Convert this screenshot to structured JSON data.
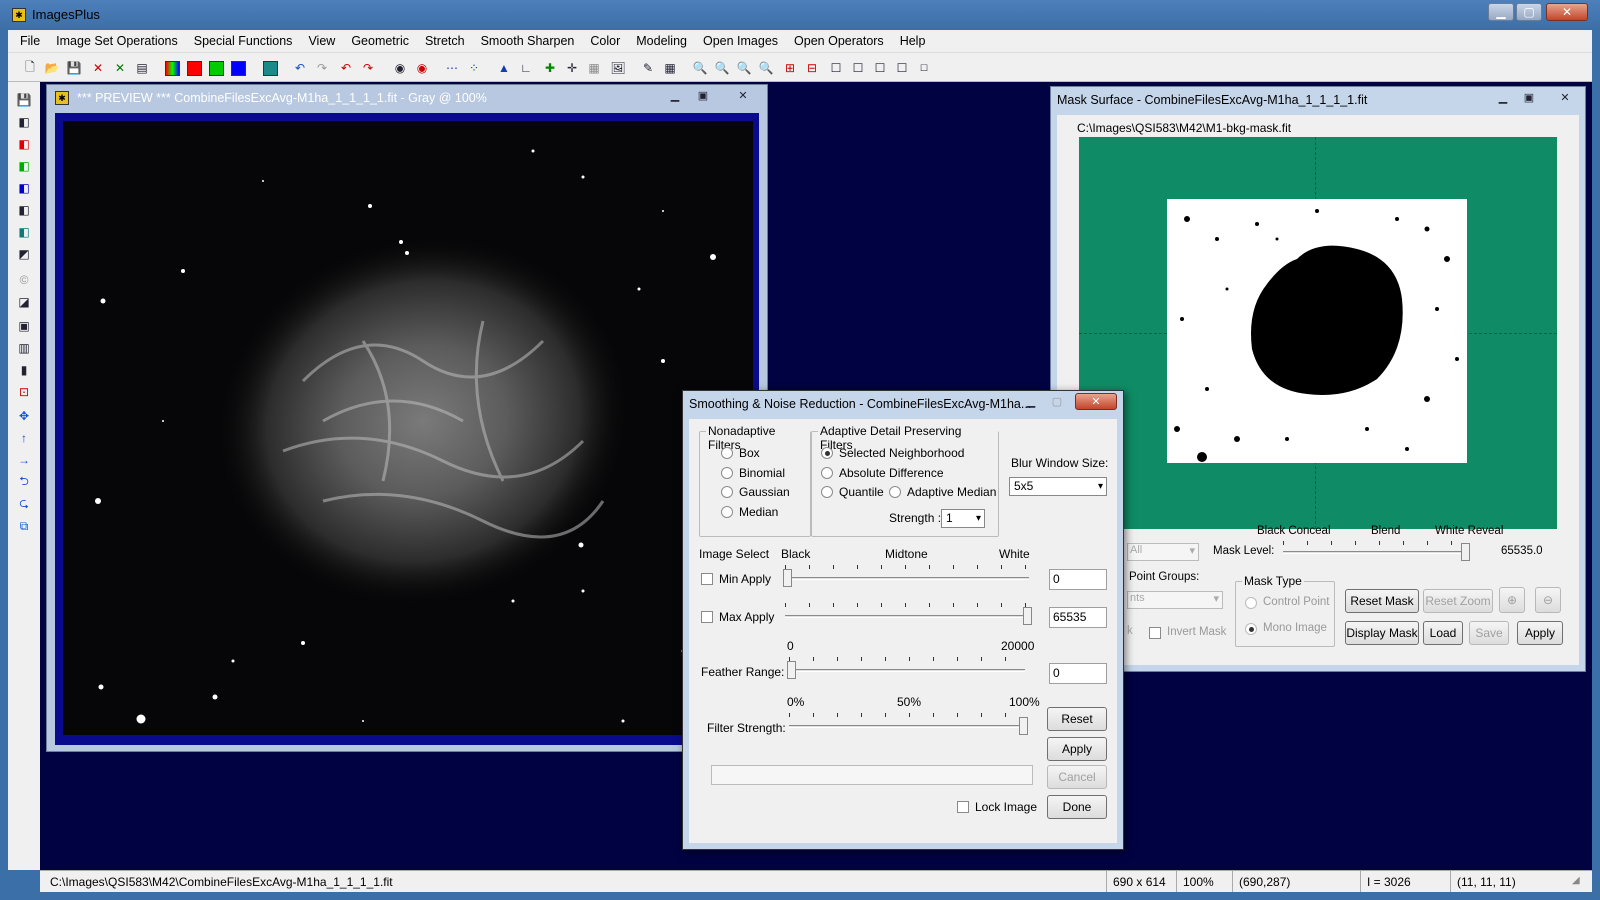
{
  "app": {
    "title": "ImagesPlus"
  },
  "menu": [
    "File",
    "Image Set Operations",
    "Special Functions",
    "View",
    "Geometric",
    "Stretch",
    "Smooth Sharpen",
    "Color",
    "Modeling",
    "Open Images",
    "Open Operators",
    "Help"
  ],
  "preview": {
    "title": "*** PREVIEW *** CombineFilesExcAvg-M1ha_1_1_1_1.fit - Gray @ 100%"
  },
  "mask_window": {
    "title": "Mask Surface - CombineFilesExcAvg-M1ha_1_1_1_1.fit",
    "path": "C:\\Images\\QSI583\\M42\\M1-bkg-mask.fit",
    "scale_labels": [
      "Black Conceal",
      "Blend",
      "White Reveal"
    ],
    "mask_level_label": "Mask Level:",
    "mask_level_value": "65535.0",
    "all_select": "All",
    "point_groups_label": "Point Groups:",
    "points_select": "nts",
    "k_label": "k",
    "invert_mask": "Invert Mask",
    "mask_type_title": "Mask Type",
    "mask_type_options": [
      "Control Point",
      "Mono Image"
    ],
    "buttons": {
      "reset_mask": "Reset Mask",
      "reset_zoom": "Reset Zoom",
      "display_mask": "Display Mask",
      "load": "Load",
      "save": "Save",
      "apply": "Apply"
    }
  },
  "dialog": {
    "title": "Smoothing & Noise Reduction - CombineFilesExcAvg-M1ha...",
    "nonadaptive_title": "Nonadaptive Filters",
    "nonadaptive": [
      "Box",
      "Binomial",
      "Gaussian",
      "Median"
    ],
    "adaptive_title": "Adaptive Detail Preserving Filters",
    "adaptive": [
      "Selected Neighborhood",
      "Absolute Difference",
      "Quantile",
      "Adaptive Median"
    ],
    "strength_label": "Strength :",
    "strength_value": "1",
    "blur_label": "Blur Window Size:",
    "blur_value": "5x5",
    "image_select": "Image Select",
    "scale1": [
      "Black",
      "Midtone",
      "White"
    ],
    "min_apply": "Min Apply",
    "min_value": "0",
    "max_apply": "Max Apply",
    "max_value": "65535",
    "feather_range_min": "0",
    "feather_range_max": "20000",
    "feather_label": "Feather Range:",
    "feather_value": "0",
    "pct": [
      "0%",
      "50%",
      "100%"
    ],
    "filter_strength": "Filter Strength:",
    "lock_image": "Lock Image",
    "buttons": {
      "reset": "Reset",
      "apply": "Apply",
      "cancel": "Cancel",
      "done": "Done"
    }
  },
  "status": {
    "path": "C:\\Images\\QSI583\\M42\\CombineFilesExcAvg-M1ha_1_1_1_1.fit",
    "size": "690 x 614",
    "zoom": "100%",
    "coords": "(690,287)",
    "intensity": "I = 3026",
    "rgb": "(11, 11, 11)"
  },
  "colors": {
    "workspace": "#010242",
    "mask_bg": "#0f8c66",
    "title_bar": "#3a6fa8"
  }
}
